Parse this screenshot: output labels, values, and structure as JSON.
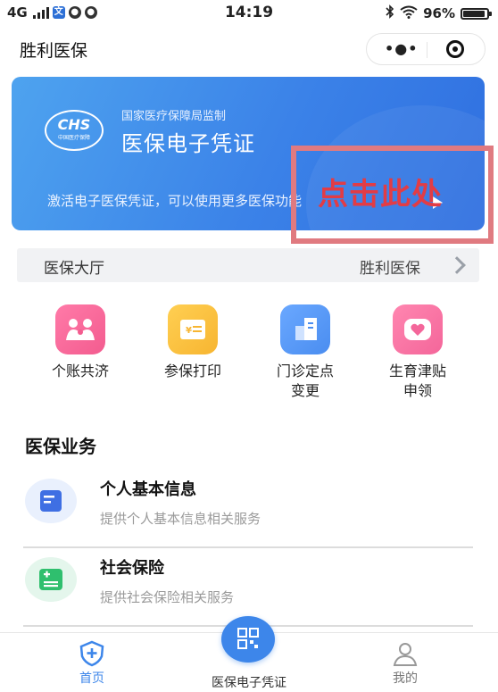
{
  "status_bar": {
    "network": "4G",
    "time": "14:19",
    "battery": "96%"
  },
  "header": {
    "title": "胜利医保"
  },
  "banner": {
    "supervisor": "国家医疗保障局监制",
    "logo_text": "CHS",
    "logo_sub": "中国医疗保障",
    "title": "医保电子凭证",
    "description": "激活电子医保凭证，可以使用更多医保功能",
    "overlay": "点击此处"
  },
  "hall": {
    "label": "医保大厅",
    "value": "胜利医保"
  },
  "shortcuts": [
    {
      "label": "个账共济",
      "icon": "family-icon",
      "color": "#f35c8f"
    },
    {
      "label": "参保打印",
      "icon": "receipt-icon",
      "color": "#f7b531"
    },
    {
      "label_line1": "门诊定点",
      "label_line2": "变更",
      "icon": "hospital-icon",
      "color": "#4a8df0"
    },
    {
      "label_line1": "生育津贴",
      "label_line2": "申领",
      "icon": "heart-icon",
      "color": "#f4669a"
    }
  ],
  "section": {
    "title": "医保业务"
  },
  "services": [
    {
      "title": "个人基本信息",
      "subtitle": "提供个人基本信息相关服务",
      "icon": "profile-card-icon",
      "color": "#3f6fe3"
    },
    {
      "title": "社会保险",
      "subtitle": "提供社会保险相关服务",
      "icon": "insurance-card-icon",
      "color": "#2fbf6e"
    }
  ],
  "tabbar": {
    "home": "首页",
    "center": "医保电子凭证",
    "mine": "我的"
  },
  "colors": {
    "accent": "#3d86ea",
    "banner": "#3b82e8",
    "overlay": "#e23c45"
  }
}
